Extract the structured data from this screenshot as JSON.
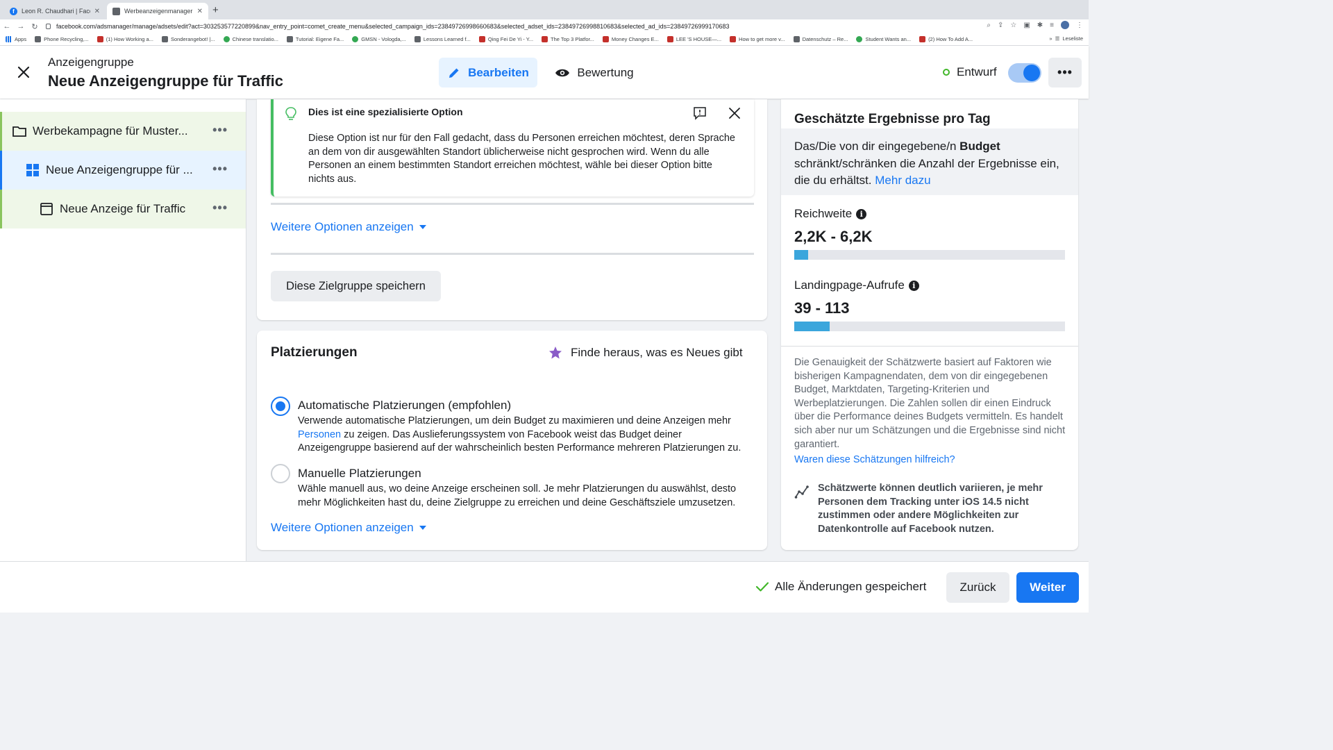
{
  "browser": {
    "tabs": [
      {
        "label": "Leon R. Chaudhari | Facebook"
      },
      {
        "label": "Werbeanzeigenmanager - Wer"
      }
    ],
    "url": "facebook.com/adsmanager/manage/adsets/edit?act=303253577220899&nav_entry_point=comet_create_menu&selected_campaign_ids=23849726998660683&selected_adset_ids=23849726998810683&selected_ad_ids=23849726999170683",
    "bookmarks": [
      "Apps",
      "Phone Recycling,...",
      "(1) How Working a...",
      "Sonderangebot! |...",
      "Chinese translatio...",
      "Tutorial: Eigene Fa...",
      "GMSN - Vologda,...",
      "Lessons Learned f...",
      "Qing Fei De Yi - Y...",
      "The Top 3 Platfor...",
      "Money Changes E...",
      "LEE 'S HOUSE—...",
      "How to get more v...",
      "Datenschutz – Re...",
      "Student Wants an...",
      "(2) How To Add A..."
    ],
    "reading_list": "Leseliste"
  },
  "header": {
    "subtitle": "Anzeigengruppe",
    "title": "Neue Anzeigengruppe für Traffic",
    "edit_label": "Bearbeiten",
    "review_label": "Bewertung",
    "status_label": "Entwurf",
    "more_label": "•••"
  },
  "nav": {
    "items": [
      {
        "label": "Werbekampagne für Muster..."
      },
      {
        "label": "Neue Anzeigengruppe für ..."
      },
      {
        "label": "Neue Anzeige für Traffic"
      }
    ],
    "more_label": "•••"
  },
  "notice": {
    "title": "Dies ist eine spezialisierte Option",
    "body": "Diese Option ist nur für den Fall gedacht, dass du Personen erreichen möchtest, deren Sprache an dem von dir ausgewählten Standort üblicherweise nicht gesprochen wird. Wenn du alle Personen an einem bestimmten Standort erreichen möchtest, wähle bei dieser Option bitte nichts aus."
  },
  "audience": {
    "more_options": "Weitere Optionen anzeigen",
    "save_button": "Diese Zielgruppe speichern"
  },
  "placements": {
    "title": "Platzierungen",
    "whats_new": "Finde heraus, was es Neues gibt",
    "auto_title": "Automatische Platzierungen (empfohlen)",
    "auto_desc_1": "Verwende automatische Platzierungen, um dein Budget zu maximieren und deine Anzeigen mehr",
    "auto_desc_link": "Personen",
    "auto_desc_2": " zu zeigen. Das Auslieferungssystem von Facebook weist das Budget deiner Anzeigengruppe basierend auf der wahrscheinlich besten Performance mehreren Platzierungen zu.",
    "manual_title": "Manuelle Platzierungen",
    "manual_desc": "Wähle manuell aus, wo deine Anzeige erscheinen soll. Je mehr Platzierungen du auswählst, desto mehr Möglichkeiten hast du, deine Zielgruppe zu erreichen und deine Geschäftsziele umzusetzen.",
    "more_options": "Weitere Optionen anzeigen",
    "selected": "auto"
  },
  "estimates": {
    "title": "Geschätzte Ergebnisse pro Tag",
    "budget_text_1": "Das/Die von dir eingegebene/n ",
    "budget_bold": "Budget",
    "budget_text_2": " schränkt/schränken die Anzahl der Ergebnisse ein, die du erhältst. ",
    "budget_link": "Mehr dazu",
    "reach_label": "Reichweite",
    "reach_value": "2,2K - 6,2K",
    "reach_fill": 0.05,
    "lp_label": "Landingpage-Aufrufe",
    "lp_value": "39 - 113",
    "lp_fill": 0.13,
    "note": "Die Genauigkeit der Schätzwerte basiert auf Faktoren wie bisherigen Kampagnendaten, dem von dir eingegebenen Budget, Marktdaten, Targeting-Kriterien und Werbeplatzierungen. Die Zahlen sollen dir einen Eindruck über die Performance deines Budgets vermitteln. Es handelt sich aber nur um Schätzungen und die Ergebnisse sind nicht garantiert.",
    "helpful_link": "Waren diese Schätzungen hilfreich?",
    "ios_note": "Schätzwerte können deutlich variieren, je mehr Personen dem Tracking unter iOS 14.5 nicht zustimmen oder andere Möglichkeiten zur Datenkontrolle auf Facebook nutzen."
  },
  "footer": {
    "saved_label": "Alle Änderungen gespeichert",
    "back_label": "Zurück",
    "next_label": "Weiter"
  },
  "colors": {
    "primary": "#1877f2",
    "success": "#42b72a",
    "bar_fill": "#3ba6dc",
    "notice_border": "#45bd62"
  }
}
